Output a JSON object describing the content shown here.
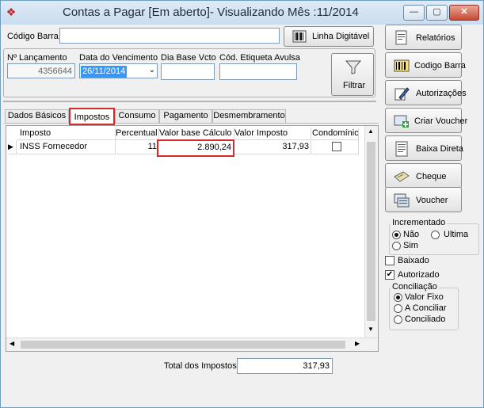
{
  "window": {
    "title": "Contas a Pagar [Em aberto]- Visualizando Mês :11/2014"
  },
  "top": {
    "codigo_barra_label": "Código Barra",
    "codigo_barra_value": "",
    "linha_digitavel_label": "Linha Digitável"
  },
  "filter": {
    "lancamento_label": "Nº Lançamento",
    "lancamento_value": "4356644",
    "vencimento_label": "Data do Vencimento",
    "vencimento_value": "26/11/2014",
    "dia_base_label": "Dia Base Vcto",
    "dia_base_value": "",
    "etiqueta_label": "Cód. Etiqueta Avulsa",
    "etiqueta_value": "",
    "filtrar_label": "Filtrar"
  },
  "tabs": [
    "Dados Básicos",
    "Impostos",
    "Consumo",
    "Pagamento",
    "Desmembramento"
  ],
  "grid": {
    "headers": [
      "Imposto",
      "Percentual",
      "Valor base Cálculo",
      "Valor Imposto",
      "Condomínio"
    ],
    "rows": [
      {
        "imposto": "INSS Fornecedor",
        "percentual": "11",
        "valor_base": "2.890,24",
        "valor_imposto": "317,93"
      }
    ]
  },
  "totals": {
    "label": "Total dos Impostos",
    "value": "317,93"
  },
  "side_buttons": [
    "Relatórios",
    "Codigo Barra",
    "Autorizações",
    "Criar Voucher",
    "Baixa Direta",
    "Cheque",
    "Voucher"
  ],
  "incrementado": {
    "title": "Incrementado",
    "nao": "Não",
    "ultima": "Ultima",
    "sim": "Sim"
  },
  "flags": {
    "baixado": "Baixado",
    "autorizado": "Autorizado"
  },
  "conciliacao": {
    "title": "Conciliação",
    "valor_fixo": "Valor Fixo",
    "a_conciliar": "A Conciliar",
    "conciliado": "Conciliado"
  },
  "colors": {
    "highlight": "#d42a2a",
    "selection": "#3399ff"
  }
}
